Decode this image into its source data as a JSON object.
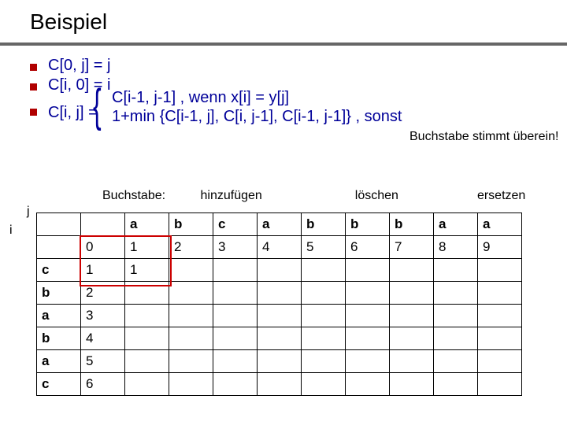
{
  "title": "Beispiel",
  "bullets": {
    "b1": "C[0, j] = j",
    "b2": "C[i, 0] = i",
    "b3_left": "C[i, j] = ",
    "case1": "C[i-1, j-1] , wenn x[i] = y[j]",
    "case2": "1+min {C[i-1, j], C[i, j-1], C[i-1, j-1]} , sonst"
  },
  "note_right": "Buchstabe stimmt überein!",
  "annot": {
    "prefix": "Buchstabe: ",
    "a1": "hinzufügen",
    "a2": "löschen",
    "a3": "ersetzen"
  },
  "axes": {
    "i": "i",
    "j": "j"
  },
  "table": {
    "col_headers": [
      "",
      "",
      "a",
      "b",
      "c",
      "a",
      "b",
      "b",
      "b",
      "a",
      "a"
    ],
    "rows": [
      {
        "hdr": "",
        "cells": [
          "0",
          "1",
          "2",
          "3",
          "4",
          "5",
          "6",
          "7",
          "8",
          "9"
        ]
      },
      {
        "hdr": "c",
        "cells": [
          "1",
          "1",
          "",
          "",
          "",
          "",
          "",
          "",
          "",
          ""
        ]
      },
      {
        "hdr": "b",
        "cells": [
          "2",
          "",
          "",
          "",
          "",
          "",
          "",
          "",
          "",
          ""
        ]
      },
      {
        "hdr": "a",
        "cells": [
          "3",
          "",
          "",
          "",
          "",
          "",
          "",
          "",
          "",
          ""
        ]
      },
      {
        "hdr": "b",
        "cells": [
          "4",
          "",
          "",
          "",
          "",
          "",
          "",
          "",
          "",
          ""
        ]
      },
      {
        "hdr": "a",
        "cells": [
          "5",
          "",
          "",
          "",
          "",
          "",
          "",
          "",
          "",
          ""
        ]
      },
      {
        "hdr": "c",
        "cells": [
          "6",
          "",
          "",
          "",
          "",
          "",
          "",
          "",
          "",
          ""
        ]
      }
    ]
  },
  "chart_data": {
    "type": "table",
    "title": "Edit distance DP table (partial)",
    "col_labels": [
      "",
      "a",
      "b",
      "c",
      "a",
      "b",
      "b",
      "b",
      "a",
      "a"
    ],
    "row_labels": [
      "",
      "c",
      "b",
      "a",
      "b",
      "a",
      "c"
    ],
    "grid": [
      [
        0,
        1,
        2,
        3,
        4,
        5,
        6,
        7,
        8,
        9
      ],
      [
        1,
        1,
        null,
        null,
        null,
        null,
        null,
        null,
        null,
        null
      ],
      [
        2,
        null,
        null,
        null,
        null,
        null,
        null,
        null,
        null,
        null
      ],
      [
        3,
        null,
        null,
        null,
        null,
        null,
        null,
        null,
        null,
        null
      ],
      [
        4,
        null,
        null,
        null,
        null,
        null,
        null,
        null,
        null,
        null
      ],
      [
        5,
        null,
        null,
        null,
        null,
        null,
        null,
        null,
        null,
        null
      ],
      [
        6,
        null,
        null,
        null,
        null,
        null,
        null,
        null,
        null,
        null
      ]
    ],
    "highlight_cells": [
      [
        0,
        0
      ],
      [
        0,
        1
      ],
      [
        1,
        0
      ],
      [
        1,
        1
      ]
    ]
  }
}
